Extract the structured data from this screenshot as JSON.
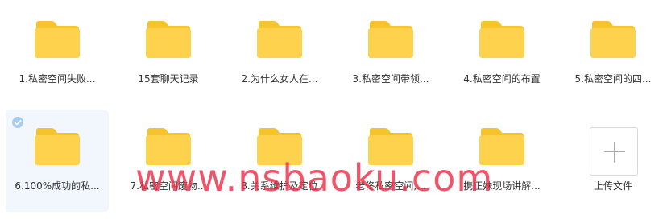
{
  "files": [
    {
      "label": "1.私密空间失败..."
    },
    {
      "label": "15套聊天记录"
    },
    {
      "label": "2.为什么女人在..."
    },
    {
      "label": "3.私密空间带领..."
    },
    {
      "label": "4.私密空间的布置"
    },
    {
      "label": "5.私密空间的四..."
    },
    {
      "label": "6.100%成功的私...",
      "selected": true
    },
    {
      "label": "7.私密空间废物..."
    },
    {
      "label": "8.关系维护及定位"
    },
    {
      "label": "老佟私密空间,..."
    },
    {
      "label": "携正妹现场讲解..."
    }
  ],
  "upload": {
    "label": "上传文件"
  },
  "watermark": {
    "text": "www.nsbaoku.com"
  },
  "colors": {
    "folder": "#ffd24d",
    "folder_tab": "#f5c32c",
    "selection_bg": "#f1f7fd",
    "check": "#a9cdf1",
    "watermark": "#e8324a"
  },
  "icons": {
    "folder": "folder-icon",
    "check": "check-icon",
    "upload": "plus-icon"
  }
}
